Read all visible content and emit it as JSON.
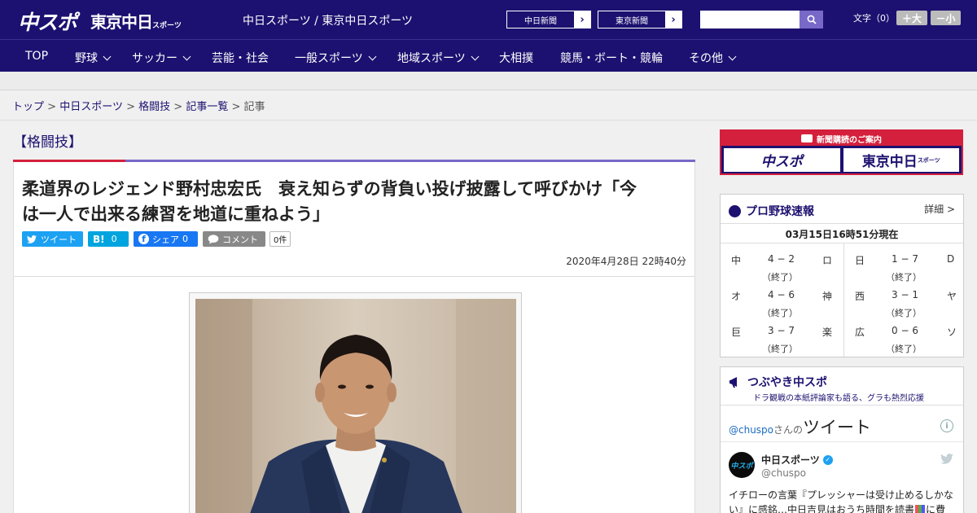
{
  "header": {
    "logo_main": "中スポ",
    "logo_tokyo": "東京中日",
    "logo_tokyo_small": "スポーツ",
    "tagline": "中日スポーツ / 東京中日スポーツ",
    "ext_links": [
      {
        "label": "中日新聞"
      },
      {
        "label": "東京新聞"
      }
    ],
    "search_placeholder": "",
    "font_size_label": "文字（0）",
    "font_up": "＋大",
    "font_down": "－小"
  },
  "nav": {
    "items": [
      {
        "label": "TOP",
        "dropdown": false
      },
      {
        "label": "野球",
        "dropdown": true
      },
      {
        "label": "サッカー",
        "dropdown": true
      },
      {
        "label": "芸能・社会",
        "dropdown": false
      },
      {
        "label": "一般スポーツ",
        "dropdown": true
      },
      {
        "label": "地域スポーツ",
        "dropdown": true
      },
      {
        "label": "大相撲",
        "dropdown": false
      },
      {
        "label": "競馬・ボート・競輪",
        "dropdown": false
      },
      {
        "label": "その他",
        "dropdown": true
      }
    ]
  },
  "breadcrumb": {
    "items": [
      "トップ",
      "中日スポーツ",
      "格闘技",
      "記事一覧"
    ],
    "current": "記事",
    "sep": ">"
  },
  "article": {
    "category": "【格闘技】",
    "headline_line1": "柔道界のレジェンド野村忠宏氏　衰え知らずの背負い投げ披露して呼びかけ「今",
    "headline_line2": "は一人で出来る練習を地道に重ねよう」",
    "share": {
      "tweet": "ツイート",
      "hatena": "B!",
      "hatena_count": "0",
      "facebook": "シェア",
      "facebook_count": "0",
      "comment": "コメント",
      "comment_count": "0件"
    },
    "date": "2020年4月28日 22時40分"
  },
  "sidebar": {
    "banner_title": "新聞購読のご案内",
    "banner_logo1": "中スポ",
    "banner_logo2": "東京中日",
    "banner_logo2_small": "スポーツ",
    "baseball": {
      "title": "プロ野球速報",
      "detail": "詳細 >",
      "timestamp": "03月15日16時51分現在",
      "games": [
        {
          "home": "中",
          "score": "4 − 2",
          "away": "ロ",
          "status": "（終了）"
        },
        {
          "home": "日",
          "score": "1 − 7",
          "away": "D",
          "status": "（終了）"
        },
        {
          "home": "オ",
          "score": "4 − 6",
          "away": "神",
          "status": "（終了）"
        },
        {
          "home": "西",
          "score": "3 − 1",
          "away": "ヤ",
          "status": "（終了）"
        },
        {
          "home": "巨",
          "score": "3 − 7",
          "away": "楽",
          "status": "（終了）"
        },
        {
          "home": "広",
          "score": "0 − 6",
          "away": "ソ",
          "status": "（終了）"
        }
      ]
    },
    "twitter": {
      "title": "つぶやき中スポ",
      "subtitle": "ドラ観戦の本紙評論家も語る、グラも熱烈応援",
      "handle_link": "@chuspo",
      "handle_suffix": "さんの",
      "tweets_word": "ツイート",
      "account_name": "中日スポーツ",
      "account_handle": "@chuspo",
      "avatar_text": "中スポ",
      "tweet_line1": "イチローの言葉『プレッシャーは受け止めるしかな",
      "tweet_line2": "い』に感銘…中日吉見はおうち時間を読書",
      "tweet_line2_tail": "に費"
    }
  },
  "colors": {
    "brand_navy": "#1c1170",
    "accent_red": "#d4203c",
    "accent_purple": "#7868c8",
    "twitter_blue": "#1da1f2",
    "hatena_blue": "#00a4de",
    "facebook_blue": "#1877f2",
    "comment_gray": "#888888"
  }
}
